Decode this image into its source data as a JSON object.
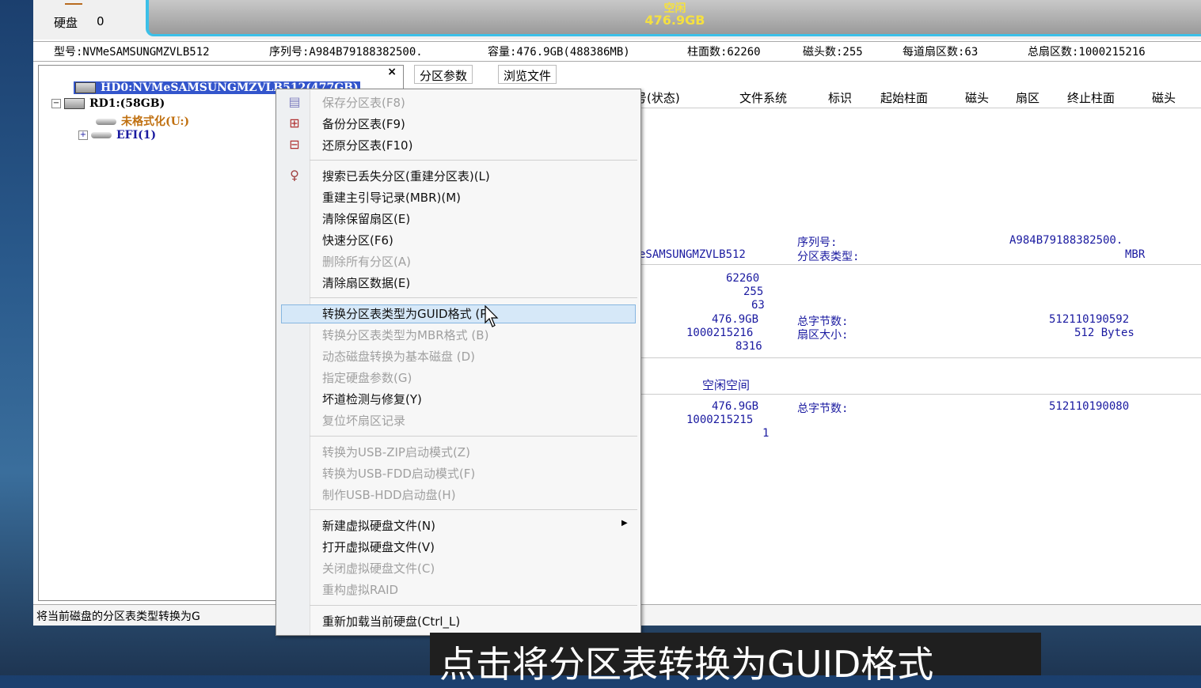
{
  "disk": {
    "label": "硬盘",
    "number": "0"
  },
  "free_block": {
    "title": "空闲",
    "size": "476.9GB"
  },
  "info": {
    "model": "型号:NVMeSAMSUNGMZVLB512",
    "serial": "序列号:A984B79188382500.",
    "capacity": "容量:476.9GB(488386MB)",
    "cylinders": "柱面数:62260",
    "heads": "磁头数:255",
    "sectors_per_track": "每道扇区数:63",
    "total_sectors": "总扇区数:1000215216"
  },
  "tree": {
    "close": "×",
    "items": [
      {
        "label": "HD0:NVMeSAMSUNGMZVLB512(477GB)"
      },
      {
        "label": "RD1:(58GB)"
      },
      {
        "label": "未格式化(U:)"
      },
      {
        "label": "EFI(1)"
      }
    ]
  },
  "tabs": [
    "分区参数",
    "浏览文件"
  ],
  "columns": [
    "序号(状态)",
    "文件系统",
    "标识",
    "起始柱面",
    "磁头",
    "扇区",
    "终止柱面",
    "磁头"
  ],
  "details": {
    "model_tail": "eSAMSUNGMZVLB512",
    "serial_label": "序列号:",
    "serial_value": "A984B79188382500.",
    "ptype_label": "分区表类型:",
    "ptype_value": "MBR",
    "cylinders": "62260",
    "heads": "255",
    "spt": "63",
    "capacity": "476.9GB",
    "total_sectors": "1000215216",
    "extra": "8316",
    "total_bytes_label": "总字节数:",
    "total_bytes_value": "512110190592",
    "sector_size_label": "扇区大小:",
    "sector_size_value": "512 Bytes",
    "free_space_title": "空闲空间",
    "free_capacity": "476.9GB",
    "free_sectors": "1000215215",
    "free_start": "1",
    "free_bytes_label": "总字节数:",
    "free_bytes_value": "512110190080"
  },
  "status": "将当前磁盘的分区表类型转换为G",
  "menu": [
    {
      "label": "保存分区表(F8)",
      "enabled": false,
      "icon": "save-icon"
    },
    {
      "label": "备份分区表(F9)",
      "enabled": true,
      "icon": "backup-icon"
    },
    {
      "label": "还原分区表(F10)",
      "enabled": true,
      "icon": "restore-icon"
    },
    {
      "label": "搜索已丢失分区(重建分区表)(L)",
      "enabled": true,
      "icon": "search-icon"
    },
    {
      "label": "重建主引导记录(MBR)(M)",
      "enabled": true
    },
    {
      "label": "清除保留扇区(E)",
      "enabled": true
    },
    {
      "label": "快速分区(F6)",
      "enabled": true
    },
    {
      "label": "删除所有分区(A)",
      "enabled": false
    },
    {
      "label": "清除扇区数据(E)",
      "enabled": true
    },
    {
      "label": "转换分区表类型为GUID格式 (P)",
      "enabled": true,
      "highlighted": true
    },
    {
      "label": "转换分区表类型为MBR格式 (B)",
      "enabled": false
    },
    {
      "label": "动态磁盘转换为基本磁盘 (D)",
      "enabled": false
    },
    {
      "label": "指定硬盘参数(G)",
      "enabled": false
    },
    {
      "label": "坏道检测与修复(Y)",
      "enabled": true
    },
    {
      "label": "复位坏扇区记录",
      "enabled": false
    },
    {
      "label": "转换为USB-ZIP启动模式(Z)",
      "enabled": false
    },
    {
      "label": "转换为USB-FDD启动模式(F)",
      "enabled": false
    },
    {
      "label": "制作USB-HDD启动盘(H)",
      "enabled": false
    },
    {
      "label": "新建虚拟硬盘文件(N)",
      "enabled": true,
      "submenu": true
    },
    {
      "label": "打开虚拟硬盘文件(V)",
      "enabled": true
    },
    {
      "label": "关闭虚拟硬盘文件(C)",
      "enabled": false
    },
    {
      "label": "重构虚拟RAID",
      "enabled": false
    },
    {
      "label": "重新加载当前硬盘(Ctrl_L)",
      "enabled": true
    }
  ],
  "caption": "点击将分区表转换为GUID格式",
  "colors": {
    "accent_blue": "#1a1aa0",
    "free_text": "#f5e040",
    "highlight": "#d6e8f8"
  }
}
